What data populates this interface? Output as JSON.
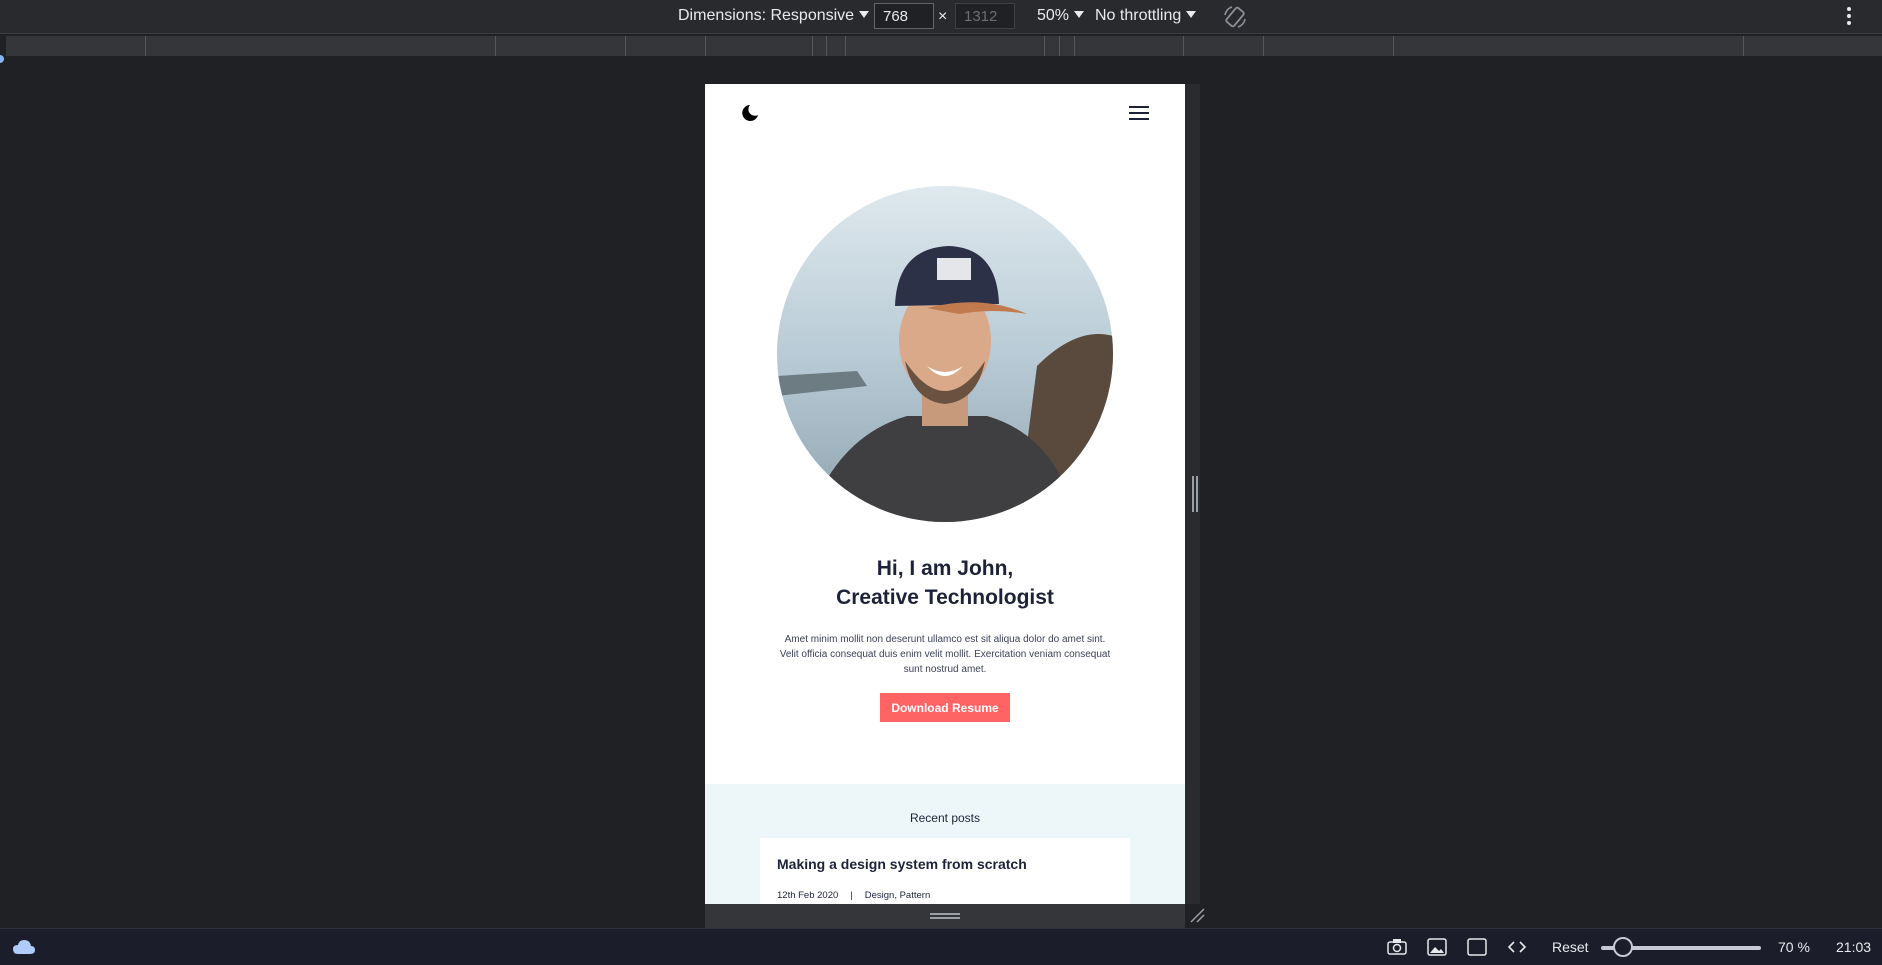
{
  "toolbar": {
    "dimensions_label": "Dimensions: Responsive",
    "width_value": "768",
    "height_placeholder": "1312",
    "times_symbol": "×",
    "zoom": "50%",
    "throttling": "No throttling",
    "icons": [
      "rotate-icon",
      "more-options-icon"
    ]
  },
  "site": {
    "nav_icons": [
      "moon-icon",
      "hamburger-menu-icon"
    ],
    "hero": {
      "title_line1": "Hi, I am John,",
      "title_line2": "Creative Technologist",
      "description": "Amet minim mollit non deserunt ullamco est sit aliqua dolor do amet sint. Velit officia consequat duis enim velit mollit. Exercitation veniam consequat sunt nostrud amet.",
      "button_label": "Download Resume"
    },
    "recent_posts": {
      "heading": "Recent posts",
      "posts": [
        {
          "title": "Making a design system from scratch",
          "date": "12th Feb 2020",
          "separator": "|",
          "tags": "Design, Pattern"
        }
      ]
    }
  },
  "taskbar": {
    "reset_label": "Reset",
    "zoom_label": "70 %",
    "zoom_level": 0.1,
    "time": "21:03",
    "icons": [
      "cloud-icon",
      "camera-icon",
      "image-icon",
      "window-icon",
      "code-icon"
    ]
  },
  "colors": {
    "devtools_bg": "#202124",
    "accent_button": "#ff6464",
    "heading_text": "#1d2238",
    "posts_bg": "#edf7fa"
  }
}
